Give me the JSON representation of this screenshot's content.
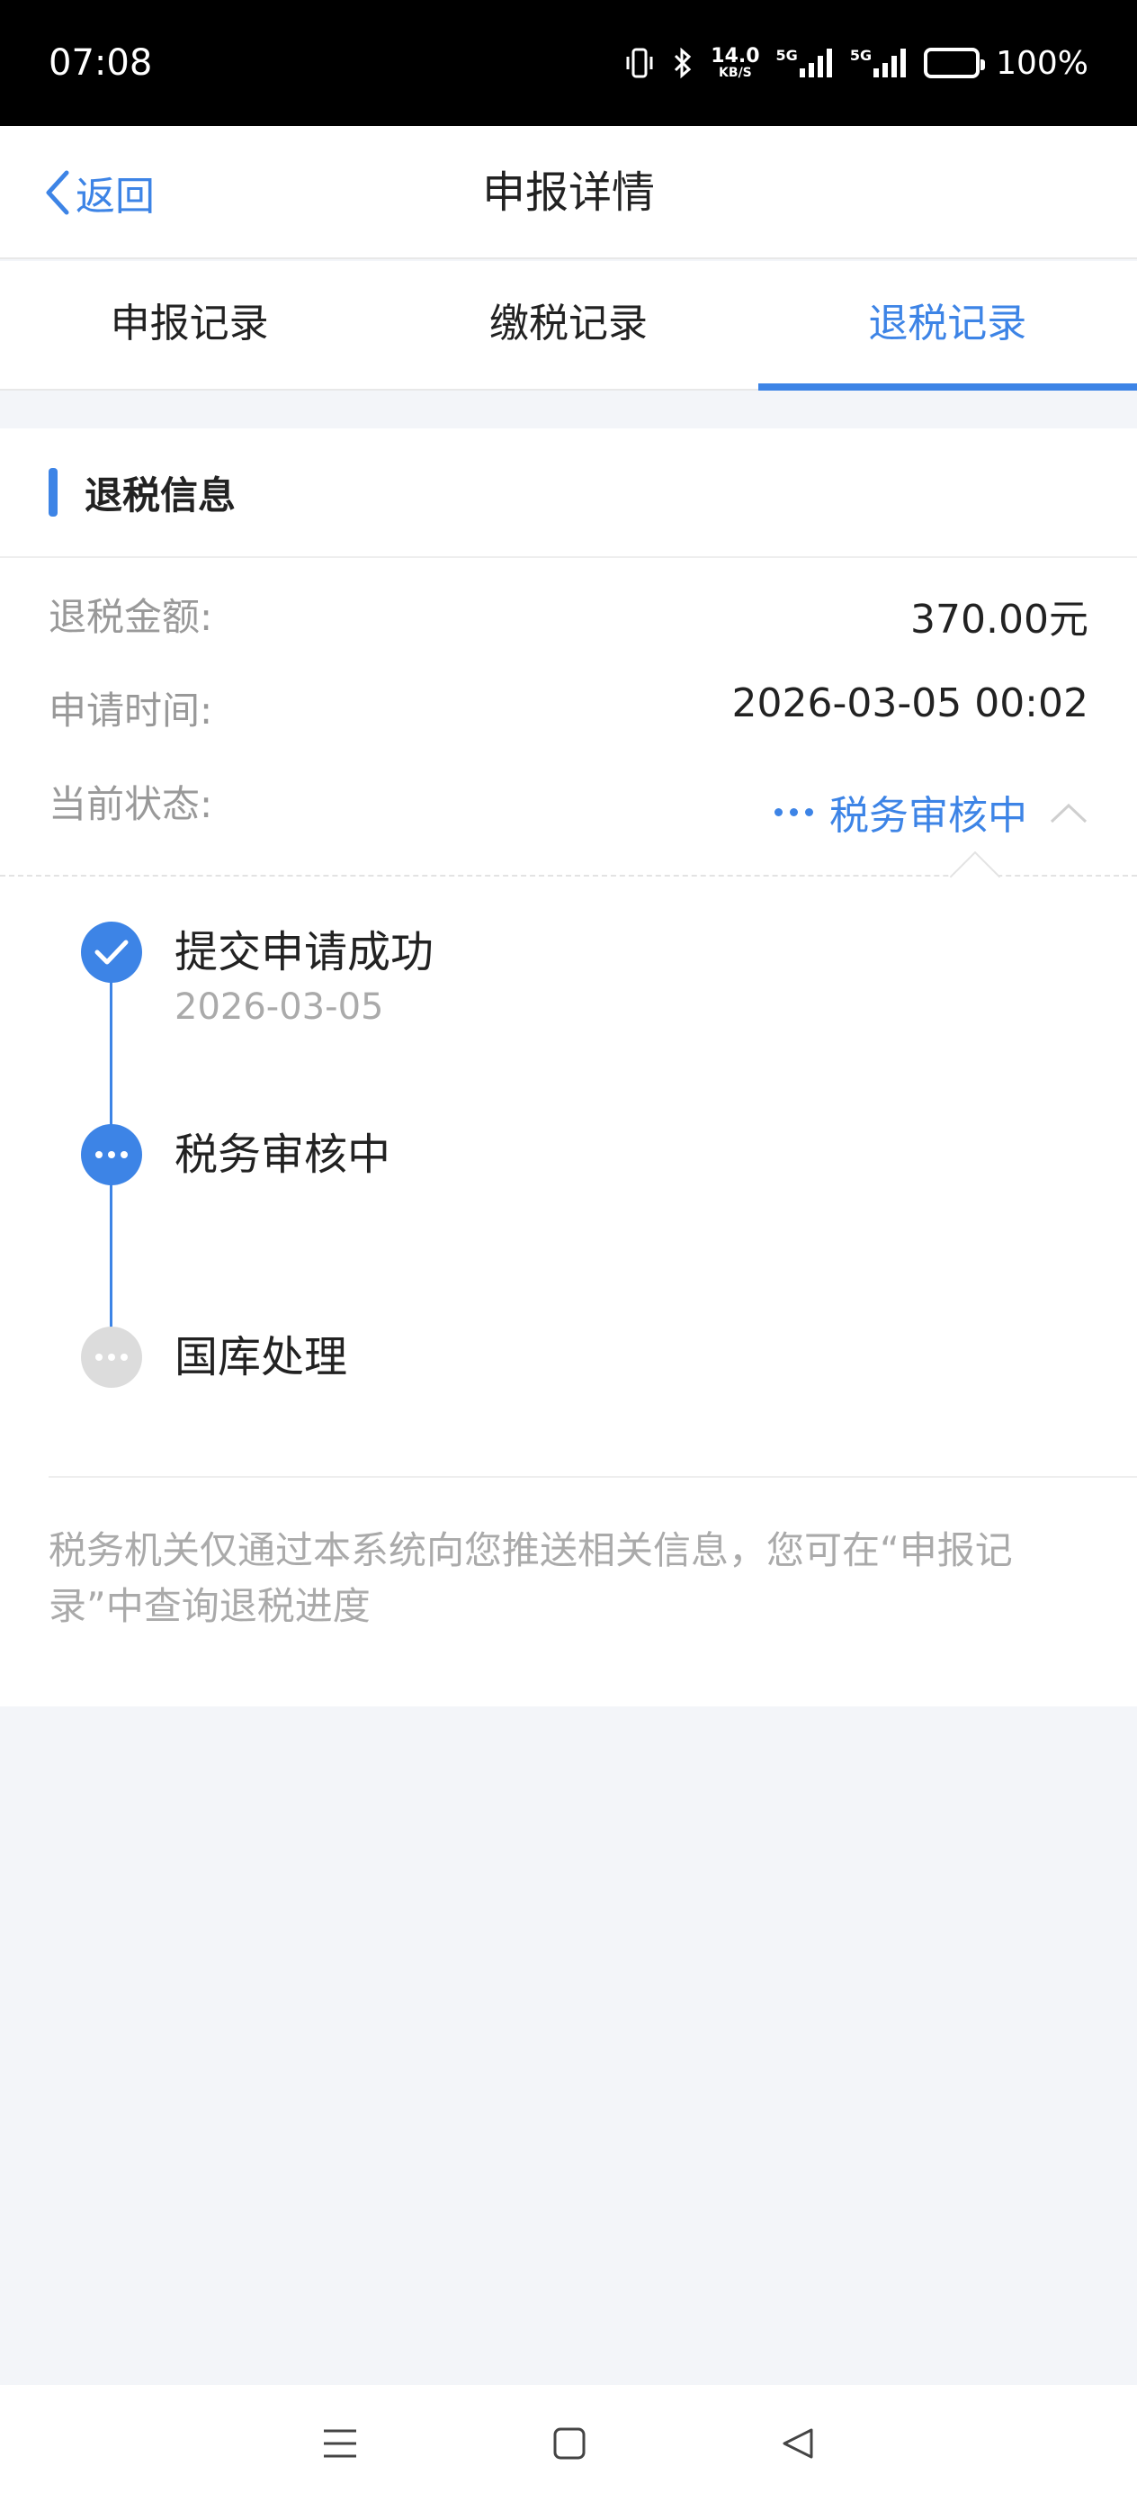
{
  "status_bar": {
    "time": "07:08",
    "net_speed_value": "14.0",
    "net_speed_unit": "KB/S",
    "signal1_label": "5G",
    "signal2_label": "5G",
    "battery_text": "100%"
  },
  "header": {
    "back_label": "返回",
    "title": "申报详情"
  },
  "tabs": [
    {
      "label": "申报记录",
      "active": false
    },
    {
      "label": "缴税记录",
      "active": false
    },
    {
      "label": "退税记录",
      "active": true
    }
  ],
  "refund": {
    "section_title": "退税信息",
    "amount_label": "退税金额:",
    "amount_value": "370.00元",
    "apply_time_label": "申请时间:",
    "apply_time_value": "2026-03-05 00:02",
    "status_label": "当前状态:",
    "status_value": "税务审核中"
  },
  "timeline": [
    {
      "title": "提交申请成功",
      "date": "2026-03-05",
      "state": "done"
    },
    {
      "title": "税务审核中",
      "date": "",
      "state": "current"
    },
    {
      "title": "国库处理",
      "date": "",
      "state": "pending"
    }
  ],
  "notice": "税务机关仅通过本系统向您推送相关信息，您可在“申报记录”中查询退税进度",
  "colors": {
    "accent": "#3d84e6",
    "pending": "#dcdcdc",
    "muted_text": "#999999",
    "page_bg": "#f3f5f9"
  }
}
